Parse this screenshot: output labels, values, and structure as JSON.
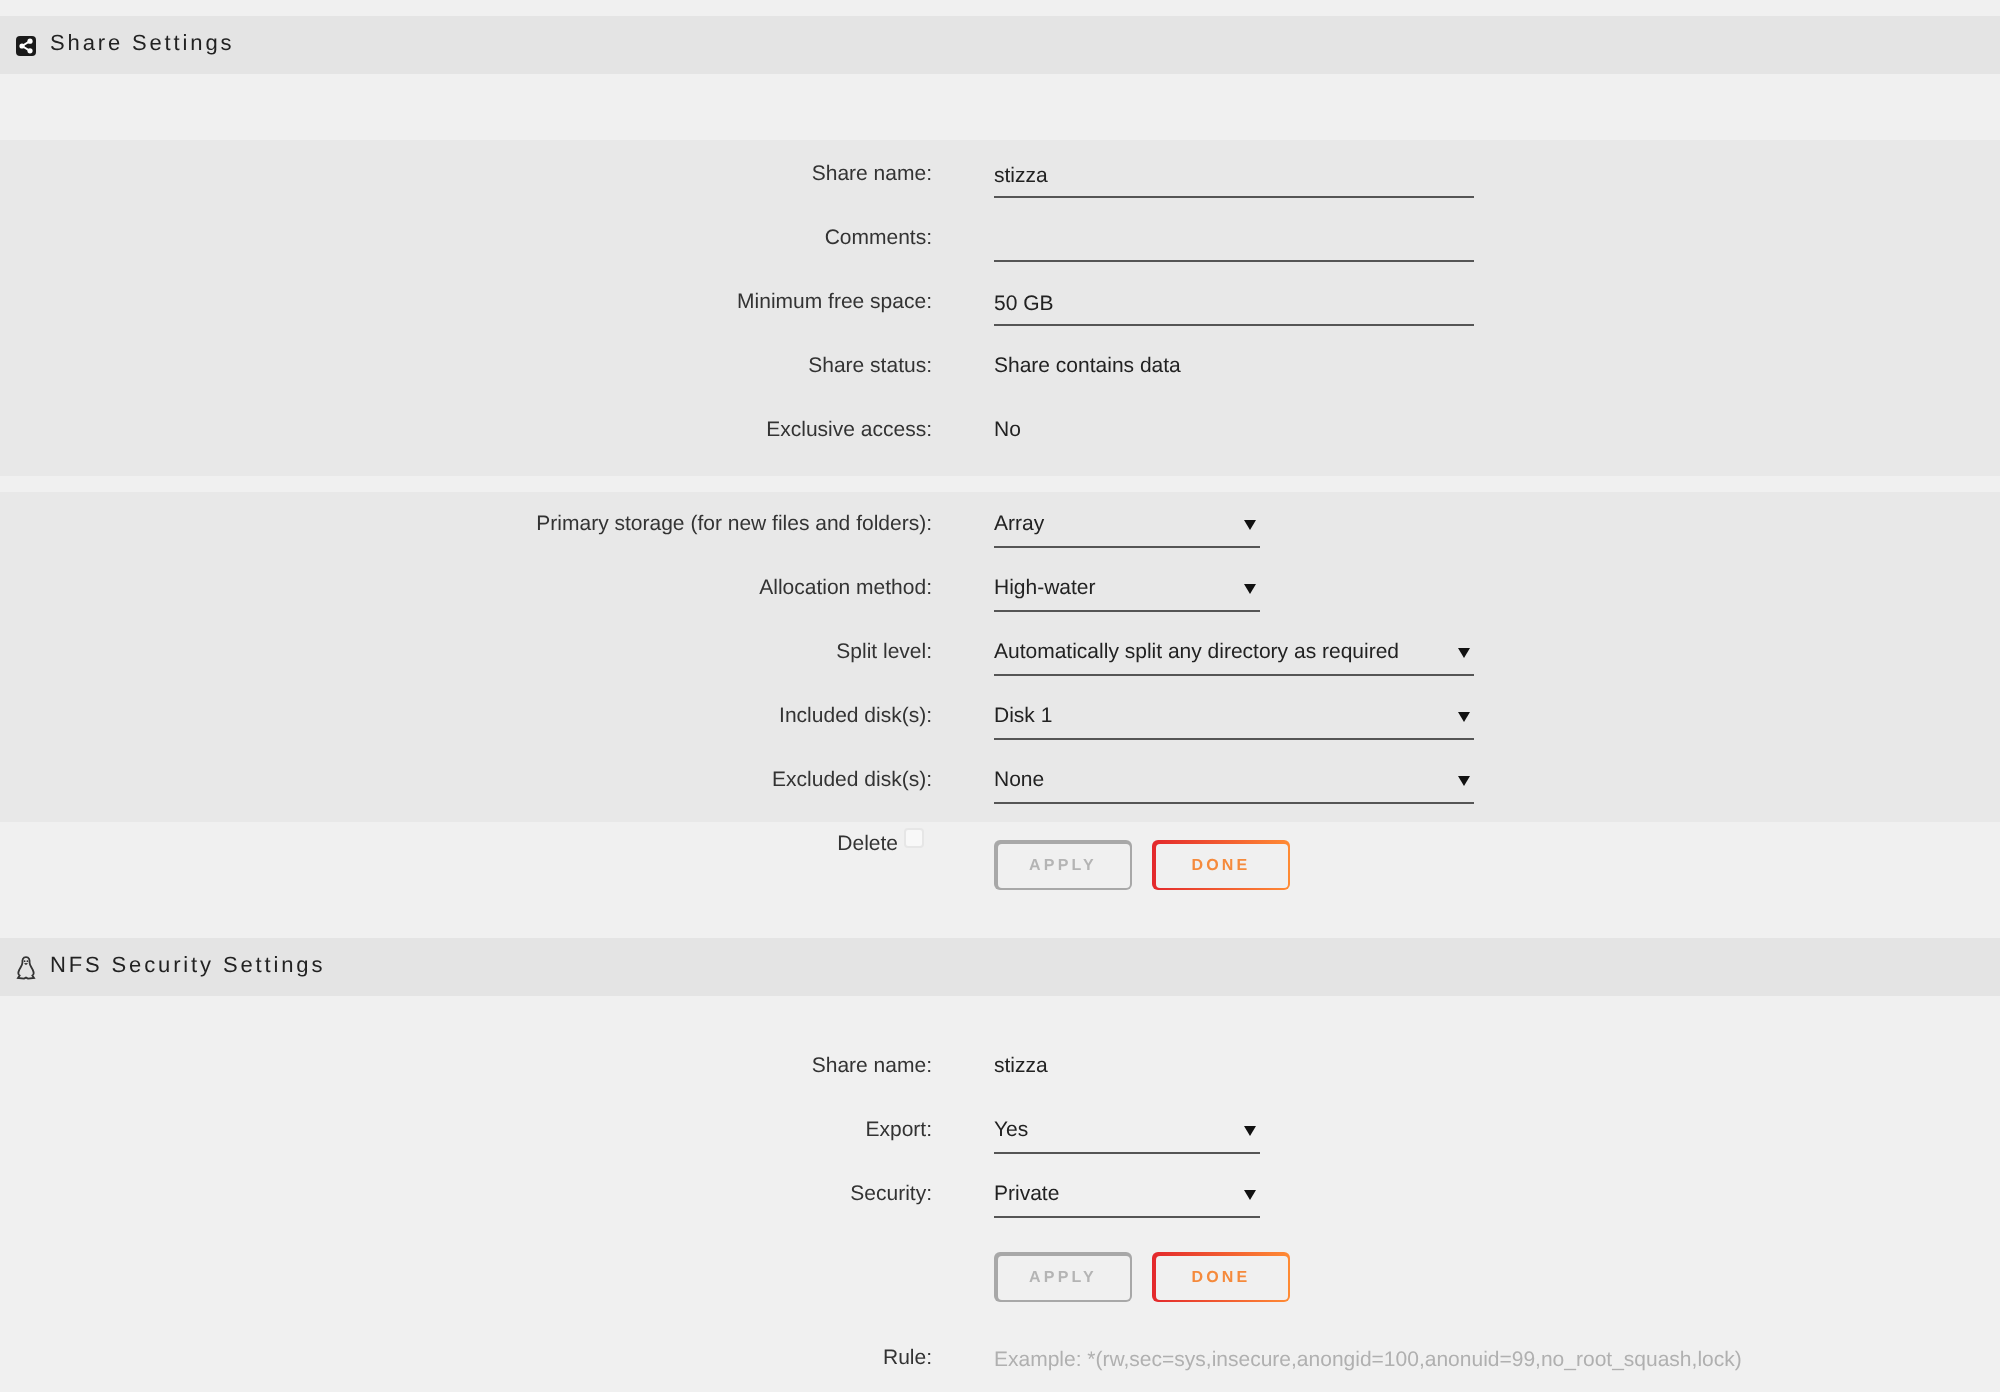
{
  "share_settings": {
    "title": "Share Settings",
    "fields": [
      {
        "kind": "input",
        "label": "Share name:",
        "value": "stizza"
      },
      {
        "kind": "input",
        "label": "Comments:"
      },
      {
        "kind": "input",
        "label": "Minimum free space:",
        "value": "50 GB"
      },
      {
        "kind": "text",
        "label": "Share status:",
        "value": "Share contains data"
      },
      {
        "kind": "text",
        "label": "Exclusive access:",
        "value": "No"
      }
    ],
    "storage_fields": [
      {
        "kind": "dropdown",
        "label": "Primary storage (for new files and folders):",
        "value": "Array"
      },
      {
        "kind": "dropdown",
        "label": "Allocation method:",
        "value": "High-water"
      },
      {
        "kind": "wide_dropdown",
        "label": "Split level:",
        "value": "Automatically split any directory as required"
      },
      {
        "kind": "wide_dropdown",
        "label": "Included disk(s):",
        "value": "Disk 1"
      },
      {
        "kind": "wide_dropdown",
        "label": "Excluded disk(s):",
        "value": "None"
      }
    ],
    "delete": {
      "label": "Delete",
      "checked": false
    },
    "buttons": [
      {
        "label": "APPLY",
        "disabled": true
      },
      {
        "label": "DONE",
        "disabled": false
      }
    ]
  },
  "nfs_security_settings": {
    "title": "NFS Security Settings",
    "fields": [
      {
        "kind": "text",
        "label": "Share name:",
        "value": "stizza"
      },
      {
        "kind": "dropdown",
        "label": "Export:",
        "value": "Yes"
      },
      {
        "kind": "dropdown",
        "label": "Security:",
        "value": "Private"
      }
    ],
    "buttons": [
      {
        "label": "APPLY",
        "disabled": true
      },
      {
        "label": "DONE",
        "disabled": false
      }
    ],
    "rule": {
      "label": "Rule:",
      "placeholder": "Example: *(rw,sec=sys,insecure,anongid=100,anonuid=99,no_root_squash,lock)"
    }
  }
}
